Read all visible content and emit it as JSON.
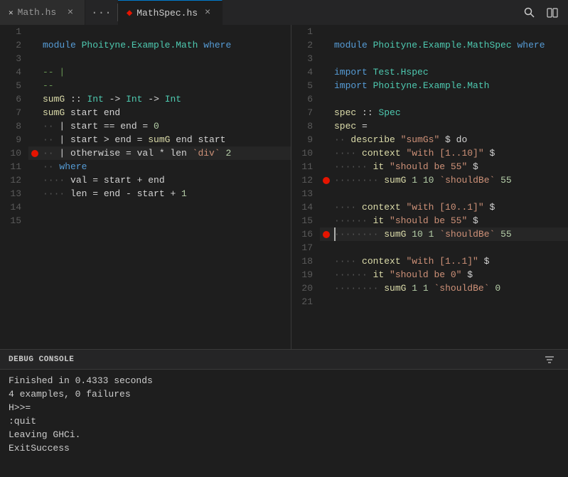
{
  "tabs": {
    "left": {
      "icon": "×",
      "filename": "Math.hs",
      "active": false,
      "close": "×"
    },
    "more": "···",
    "right": {
      "icon": "◆",
      "filename": "MathSpec.hs",
      "active": true,
      "close": "×"
    },
    "search_icon": "🔍",
    "split_icon": "⧉"
  },
  "left_code": [
    {
      "ln": "1",
      "code": "",
      "parts": []
    },
    {
      "ln": "2",
      "code": "module Phoityne.Example.Math where",
      "parts": [
        {
          "t": "kw",
          "v": "module"
        },
        {
          "t": "",
          "v": " "
        },
        {
          "t": "mod",
          "v": "Phoityne.Example.Math"
        },
        {
          "t": "",
          "v": " "
        },
        {
          "t": "kw",
          "v": "where"
        }
      ]
    },
    {
      "ln": "3",
      "code": "",
      "parts": []
    },
    {
      "ln": "4",
      "code": "-- |",
      "parts": [
        {
          "t": "comment",
          "v": "-- |"
        }
      ]
    },
    {
      "ln": "5",
      "code": "--",
      "parts": [
        {
          "t": "comment",
          "v": "--"
        }
      ]
    },
    {
      "ln": "6",
      "code": "sumG :: Int -> Int -> Int",
      "parts": [
        {
          "t": "fn",
          "v": "sumG"
        },
        {
          "t": "",
          "v": " :: "
        },
        {
          "t": "type",
          "v": "Int"
        },
        {
          "t": "",
          "v": " -> "
        },
        {
          "t": "type",
          "v": "Int"
        },
        {
          "t": "",
          "v": " -> "
        },
        {
          "t": "type",
          "v": "Int"
        }
      ]
    },
    {
      "ln": "7",
      "code": "sumG start end",
      "parts": [
        {
          "t": "fn",
          "v": "sumG"
        },
        {
          "t": "",
          "v": " start end"
        }
      ]
    },
    {
      "ln": "8",
      "code": "  | start == end = 0",
      "parts": [
        {
          "t": "dots",
          "v": "·· "
        },
        {
          "t": "",
          "v": "| start == end = "
        },
        {
          "t": "num",
          "v": "0"
        }
      ]
    },
    {
      "ln": "9",
      "code": "  | start > end = sumG end start",
      "parts": [
        {
          "t": "dots",
          "v": "·· "
        },
        {
          "t": "",
          "v": "| start > end = "
        },
        {
          "t": "fn",
          "v": "sumG"
        },
        {
          "t": "",
          "v": " end start"
        }
      ]
    },
    {
      "ln": "10",
      "code": "  | otherwise = val * len `div` 2",
      "parts": [
        {
          "t": "dots",
          "v": "·· "
        },
        {
          "t": "",
          "v": "| otherwise = val * len "
        },
        {
          "t": "tick",
          "v": "`div`"
        },
        {
          "t": "",
          "v": " "
        },
        {
          "t": "num",
          "v": "2"
        }
      ],
      "breakpoint": true,
      "highlighted": true
    },
    {
      "ln": "11",
      "code": "  where",
      "parts": [
        {
          "t": "dots",
          "v": "·· "
        },
        {
          "t": "kw",
          "v": "where"
        }
      ]
    },
    {
      "ln": "12",
      "code": "    val = start + end",
      "parts": [
        {
          "t": "dots",
          "v": "···· "
        },
        {
          "t": "",
          "v": "val = start + end"
        }
      ]
    },
    {
      "ln": "13",
      "code": "    len = end - start + 1",
      "parts": [
        {
          "t": "dots",
          "v": "···· "
        },
        {
          "t": "",
          "v": "len = end - start + "
        },
        {
          "t": "num",
          "v": "1"
        }
      ]
    },
    {
      "ln": "14",
      "code": "",
      "parts": []
    },
    {
      "ln": "15",
      "code": "",
      "parts": []
    }
  ],
  "right_code": [
    {
      "ln": "1",
      "parts": []
    },
    {
      "ln": "2",
      "parts": [
        {
          "t": "kw",
          "v": "module"
        },
        {
          "t": "",
          "v": " "
        },
        {
          "t": "mod",
          "v": "Phoityne.Example.MathSpec"
        },
        {
          "t": "",
          "v": " "
        },
        {
          "t": "kw",
          "v": "where"
        }
      ]
    },
    {
      "ln": "3",
      "parts": []
    },
    {
      "ln": "4",
      "parts": [
        {
          "t": "kw",
          "v": "import"
        },
        {
          "t": "",
          "v": " "
        },
        {
          "t": "mod",
          "v": "Test.Hspec"
        }
      ]
    },
    {
      "ln": "5",
      "parts": [
        {
          "t": "kw",
          "v": "import"
        },
        {
          "t": "",
          "v": " "
        },
        {
          "t": "mod",
          "v": "Phoityne.Example.Math"
        }
      ]
    },
    {
      "ln": "6",
      "parts": []
    },
    {
      "ln": "7",
      "parts": [
        {
          "t": "fn",
          "v": "spec"
        },
        {
          "t": "",
          "v": " :: "
        },
        {
          "t": "type",
          "v": "Spec"
        }
      ]
    },
    {
      "ln": "8",
      "parts": [
        {
          "t": "fn",
          "v": "spec"
        },
        {
          "t": "",
          "v": " ="
        }
      ]
    },
    {
      "ln": "9",
      "parts": [
        {
          "t": "dots",
          "v": "·· "
        },
        {
          "t": "fn",
          "v": "describe"
        },
        {
          "t": "",
          "v": " "
        },
        {
          "t": "str",
          "v": "\"sumGs\""
        },
        {
          "t": "",
          "v": " $ do"
        }
      ]
    },
    {
      "ln": "10",
      "parts": [
        {
          "t": "dots",
          "v": "···· "
        },
        {
          "t": "fn",
          "v": "context"
        },
        {
          "t": "",
          "v": " "
        },
        {
          "t": "str",
          "v": "\"with [1..10]\""
        },
        {
          "t": "",
          "v": " $"
        }
      ]
    },
    {
      "ln": "11",
      "parts": [
        {
          "t": "dots",
          "v": "······ "
        },
        {
          "t": "fn",
          "v": "it"
        },
        {
          "t": "",
          "v": " "
        },
        {
          "t": "str",
          "v": "\"should be 55\""
        },
        {
          "t": "",
          "v": " $"
        }
      ]
    },
    {
      "ln": "12",
      "parts": [
        {
          "t": "dots",
          "v": "········ "
        },
        {
          "t": "fn",
          "v": "sumG"
        },
        {
          "t": "",
          "v": " "
        },
        {
          "t": "num",
          "v": "1"
        },
        {
          "t": "",
          "v": " "
        },
        {
          "t": "num",
          "v": "10"
        },
        {
          "t": "",
          "v": " "
        },
        {
          "t": "tick",
          "v": "`shouldBe`"
        },
        {
          "t": "",
          "v": " "
        },
        {
          "t": "num",
          "v": "55"
        }
      ],
      "breakpoint": true
    },
    {
      "ln": "13",
      "parts": []
    },
    {
      "ln": "14",
      "parts": [
        {
          "t": "dots",
          "v": "···· "
        },
        {
          "t": "fn",
          "v": "context"
        },
        {
          "t": "",
          "v": " "
        },
        {
          "t": "str",
          "v": "\"with [10..1]\""
        },
        {
          "t": "",
          "v": " $"
        }
      ]
    },
    {
      "ln": "15",
      "parts": [
        {
          "t": "dots",
          "v": "······ "
        },
        {
          "t": "fn",
          "v": "it"
        },
        {
          "t": "",
          "v": " "
        },
        {
          "t": "str",
          "v": "\"should be 55\""
        },
        {
          "t": "",
          "v": " $"
        }
      ]
    },
    {
      "ln": "16",
      "parts": [
        {
          "t": "dots",
          "v": "········ "
        },
        {
          "t": "fn",
          "v": "sumG"
        },
        {
          "t": "",
          "v": " "
        },
        {
          "t": "num",
          "v": "10"
        },
        {
          "t": "",
          "v": " "
        },
        {
          "t": "num",
          "v": "1"
        },
        {
          "t": "",
          "v": " "
        },
        {
          "t": "tick",
          "v": "`shouldBe`"
        },
        {
          "t": "",
          "v": " "
        },
        {
          "t": "num",
          "v": "55"
        }
      ],
      "breakpoint": true,
      "cursor": true,
      "highlighted": true
    },
    {
      "ln": "17",
      "parts": []
    },
    {
      "ln": "18",
      "parts": [
        {
          "t": "dots",
          "v": "···· "
        },
        {
          "t": "fn",
          "v": "context"
        },
        {
          "t": "",
          "v": " "
        },
        {
          "t": "str",
          "v": "\"with [1..1]\""
        },
        {
          "t": "",
          "v": " $"
        }
      ]
    },
    {
      "ln": "19",
      "parts": [
        {
          "t": "dots",
          "v": "······ "
        },
        {
          "t": "fn",
          "v": "it"
        },
        {
          "t": "",
          "v": " "
        },
        {
          "t": "str",
          "v": "\"should be 0\""
        },
        {
          "t": "",
          "v": " $"
        }
      ]
    },
    {
      "ln": "20",
      "parts": [
        {
          "t": "dots",
          "v": "········ "
        },
        {
          "t": "fn",
          "v": "sumG"
        },
        {
          "t": "",
          "v": " "
        },
        {
          "t": "num",
          "v": "1"
        },
        {
          "t": "",
          "v": " "
        },
        {
          "t": "num",
          "v": "1"
        },
        {
          "t": "",
          "v": " "
        },
        {
          "t": "tick",
          "v": "`shouldBe`"
        },
        {
          "t": "",
          "v": " "
        },
        {
          "t": "num",
          "v": "0"
        }
      ]
    },
    {
      "ln": "21",
      "parts": []
    }
  ],
  "debug": {
    "title": "DEBUG CONSOLE",
    "lines": [
      "Finished in 0.4333 seconds",
      "4 examples, 0 failures",
      "H>>=",
      ":quit",
      "Leaving GHCi.",
      "ExitSuccess"
    ]
  }
}
